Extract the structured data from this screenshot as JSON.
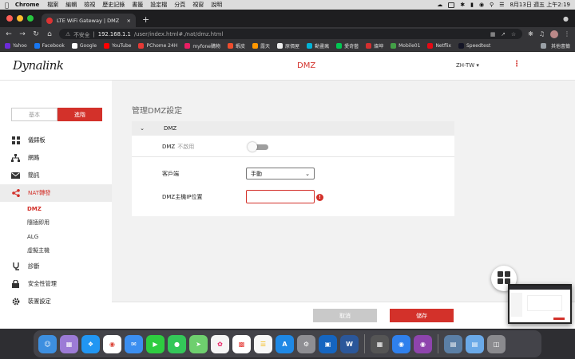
{
  "menubar": {
    "app": "Chrome",
    "items": [
      "檔案",
      "編輯",
      "檢視",
      "歷史記錄",
      "書籤",
      "設定檔",
      "分頁",
      "視窗",
      "說明"
    ],
    "datetime": "8月13日 週五 上午2:19"
  },
  "browser": {
    "tab_title": "LTE WiFi Gateway | DMZ",
    "address": {
      "insecure_label": "不安全",
      "host": "192.168.1.1",
      "path": "/user/index.html#./nat/dmz.html"
    },
    "bookmarks": [
      "Yahoo",
      "Facebook",
      "Google",
      "YouTube",
      "PChome 24H",
      "myfone購物",
      "蝦皮",
      "露天",
      "原價屋",
      "動畫瘋",
      "愛奇藝",
      "燦坤",
      "Mobile01",
      "Netflix",
      "Speedtest"
    ],
    "other_bookmarks": "其他書籤"
  },
  "header": {
    "logo": "Dynalink",
    "title": "DMZ",
    "language": "ZH-TW"
  },
  "sidebar": {
    "mode_basic": "基本",
    "mode_advanced": "進階",
    "items": [
      {
        "label": "儀錶板",
        "icon": "dashboard-icon"
      },
      {
        "label": "網路",
        "icon": "network-icon"
      },
      {
        "label": "簡訊",
        "icon": "mail-icon"
      },
      {
        "label": "NAT轉發",
        "icon": "share-icon",
        "active": true
      },
      {
        "label": "診斷",
        "icon": "diagnostics-icon"
      },
      {
        "label": "安全性管理",
        "icon": "lock-icon"
      },
      {
        "label": "裝置設定",
        "icon": "gear-icon"
      }
    ],
    "nat_subitems": [
      "DMZ",
      "隨插即用",
      "ALG",
      "虛擬主機"
    ]
  },
  "main": {
    "section_title": "管理DMZ設定",
    "card_title": "DMZ",
    "dmz_label": "DMZ",
    "dmz_state": "不啟用",
    "client_label": "客戶端",
    "client_value": "手動",
    "host_ip_label": "DMZ主機IP位置",
    "host_ip_value": "",
    "error_glyph": "!"
  },
  "footer": {
    "cancel_label": "取消",
    "save_label": "儲存"
  },
  "colors": {
    "accent": "#d3312a",
    "sidebar_active_bg": "#ececec",
    "toggle_off": "#9e9e9e"
  }
}
